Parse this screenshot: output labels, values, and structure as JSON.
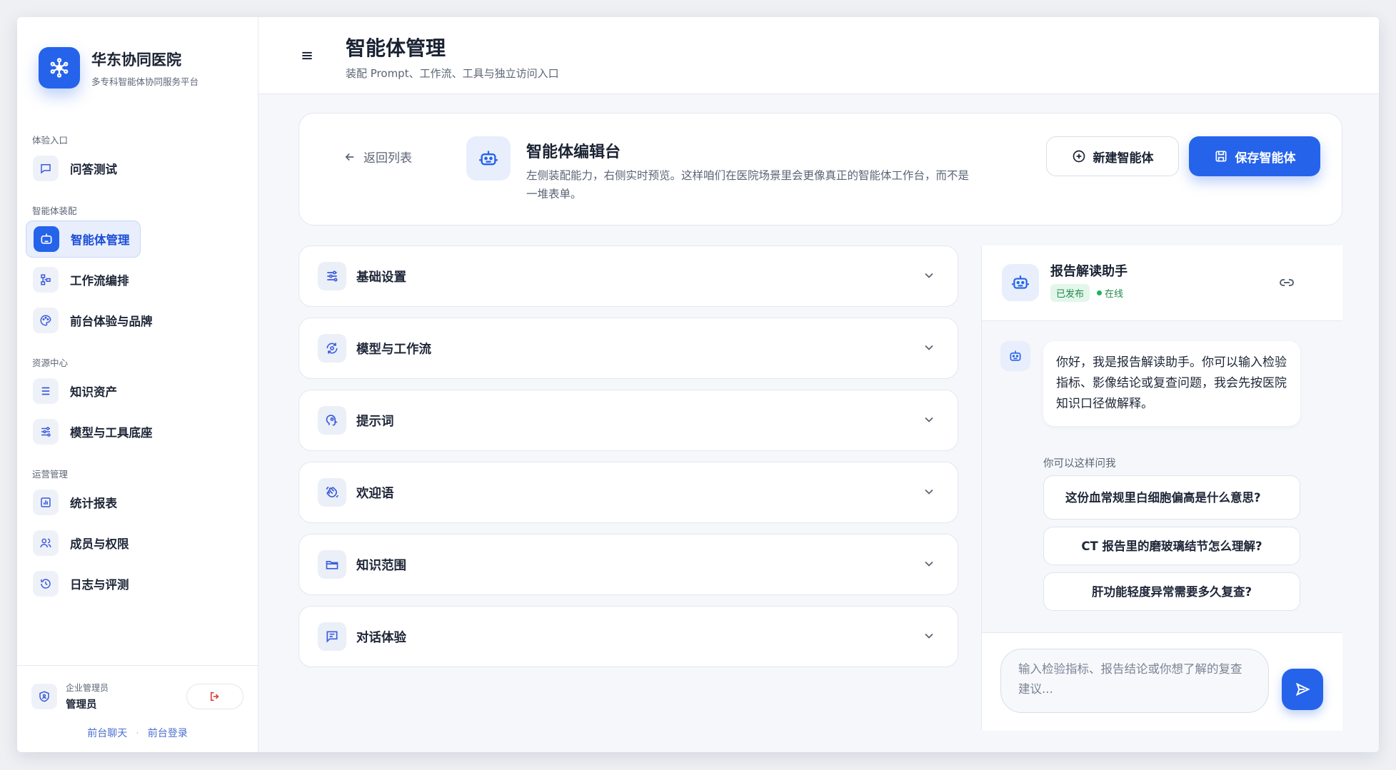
{
  "brand": {
    "name": "华东协同医院",
    "subtitle": "多专科智能体协同服务平台"
  },
  "sidebar": {
    "sections": [
      {
        "title": "体验入口",
        "items": [
          {
            "label": "问答测试",
            "icon": "chat-icon"
          }
        ]
      },
      {
        "title": "智能体装配",
        "items": [
          {
            "label": "智能体管理",
            "icon": "robot-icon",
            "active": true
          },
          {
            "label": "工作流编排",
            "icon": "workflow-icon"
          },
          {
            "label": "前台体验与品牌",
            "icon": "palette-icon"
          }
        ]
      },
      {
        "title": "资源中心",
        "items": [
          {
            "label": "知识资产",
            "icon": "list-icon"
          },
          {
            "label": "模型与工具底座",
            "icon": "sliders-icon"
          }
        ]
      },
      {
        "title": "运营管理",
        "items": [
          {
            "label": "统计报表",
            "icon": "chart-icon"
          },
          {
            "label": "成员与权限",
            "icon": "users-icon"
          },
          {
            "label": "日志与评测",
            "icon": "history-icon"
          }
        ]
      }
    ]
  },
  "user": {
    "role": "企业管理员",
    "name": "管理员"
  },
  "footer_links": [
    "前台聊天",
    "前台登录"
  ],
  "header": {
    "title": "智能体管理",
    "subtitle": "装配 Prompt、工作流、工具与独立访问入口"
  },
  "editor": {
    "back_label": "返回列表",
    "title": "智能体编辑台",
    "description": "左侧装配能力，右侧实时预览。这样咱们在医院场景里会更像真正的智能体工作台，而不是一堆表单。",
    "new_button": "新建智能体",
    "save_button": "保存智能体"
  },
  "sections": [
    {
      "label": "基础设置",
      "icon": "sliders-icon"
    },
    {
      "label": "模型与工作流",
      "icon": "model-cycle-icon"
    },
    {
      "label": "提示词",
      "icon": "prompt-head-icon"
    },
    {
      "label": "欢迎语",
      "icon": "wave-hand-icon"
    },
    {
      "label": "知识范围",
      "icon": "folder-icon"
    },
    {
      "label": "对话体验",
      "icon": "message-icon"
    }
  ],
  "preview": {
    "agent_name": "报告解读助手",
    "badge_published": "已发布",
    "badge_online": "在线",
    "greeting": "你好，我是报告解读助手。你可以输入检验指标、影像结论或复查问题，我会先按医院知识口径做解释。",
    "suggestion_title": "你可以这样问我",
    "suggestions": [
      "这份血常规里白细胞偏高是什么意思?",
      "CT 报告里的磨玻璃结节怎么理解?",
      "肝功能轻度异常需要多久复查?"
    ],
    "input_placeholder": "输入检验指标、报告结论或你想了解的复查建议..."
  },
  "colors": {
    "accent": "#2563eb",
    "success": "#1f8a4c",
    "danger": "#e03131"
  }
}
